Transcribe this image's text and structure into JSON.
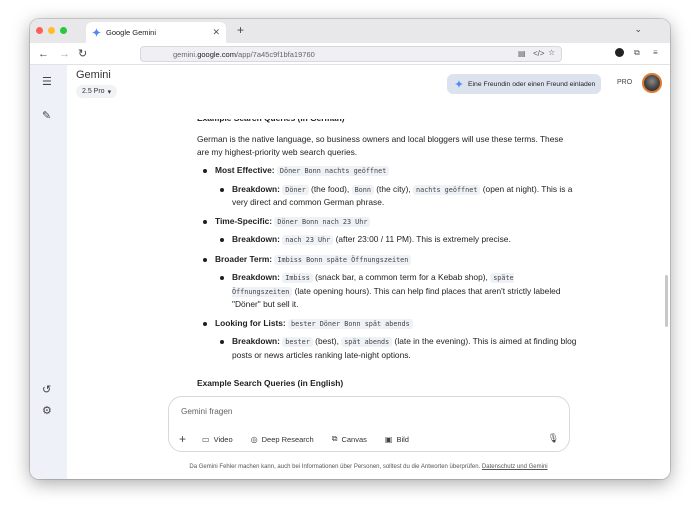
{
  "browser": {
    "tab_title": "Google Gemini",
    "url_prefix": "gemini.",
    "url_domain": "google.com",
    "url_path": "/app/7a45c9f1bfa19760",
    "traffic_colors": [
      "#ff5f57",
      "#febc2e",
      "#28c840"
    ]
  },
  "app": {
    "title": "Gemini",
    "model": "2.5 Pro",
    "invite_label": "Eine Freundin oder einen Freund einladen",
    "pro_badge": "PRO"
  },
  "content": {
    "cut_heading": "Example Search Queries (in German)",
    "intro": "German is the native language, so business owners and local bloggers will use these terms. These are my highest-priority web search queries.",
    "items": [
      {
        "label": "Most Effective:",
        "query": "Döner Bonn nachts geöffnet",
        "breakdown_label": "Breakdown:",
        "parts": [
          {
            "code": "Döner",
            "text": " (the food), "
          },
          {
            "code": "Bonn",
            "text": " (the city), "
          },
          {
            "code": "nachts geöffnet",
            "text": " (open at night). This is a very direct and common German phrase."
          }
        ]
      },
      {
        "label": "Time-Specific:",
        "query": "Döner Bonn nach 23 Uhr",
        "breakdown_label": "Breakdown:",
        "parts": [
          {
            "code": "nach 23 Uhr",
            "text": " (after 23:00 / 11 PM). This is extremely precise."
          }
        ]
      },
      {
        "label": "Broader Term:",
        "query": "Imbiss Bonn späte Öffnungszeiten",
        "breakdown_label": "Breakdown:",
        "parts": [
          {
            "code": "Imbiss",
            "text": " (snack bar, a common term for a Kebab shop), "
          },
          {
            "code": "späte Öffnungszeiten",
            "text": " (late opening hours). This can help find places that aren't strictly labeled \"Döner\" but sell it."
          }
        ]
      },
      {
        "label": "Looking for Lists:",
        "query": "bester Döner Bonn spät abends",
        "breakdown_label": "Breakdown:",
        "parts": [
          {
            "code": "bester",
            "text": " (best), "
          },
          {
            "code": "spät abends",
            "text": " (late in the evening). This is aimed at finding blog posts or news articles ranking late-night options."
          }
        ]
      }
    ],
    "english_heading": "Example Search Queries (in English)"
  },
  "input": {
    "placeholder": "Gemini fragen",
    "tools": [
      "Video",
      "Deep Research",
      "Canvas",
      "Bild"
    ]
  },
  "footer": {
    "text": "Da Gemini Fehler machen kann, auch bei Informationen über Personen, solltest du die Antworten überprüfen. ",
    "link": "Datenschutz und Gemini"
  }
}
